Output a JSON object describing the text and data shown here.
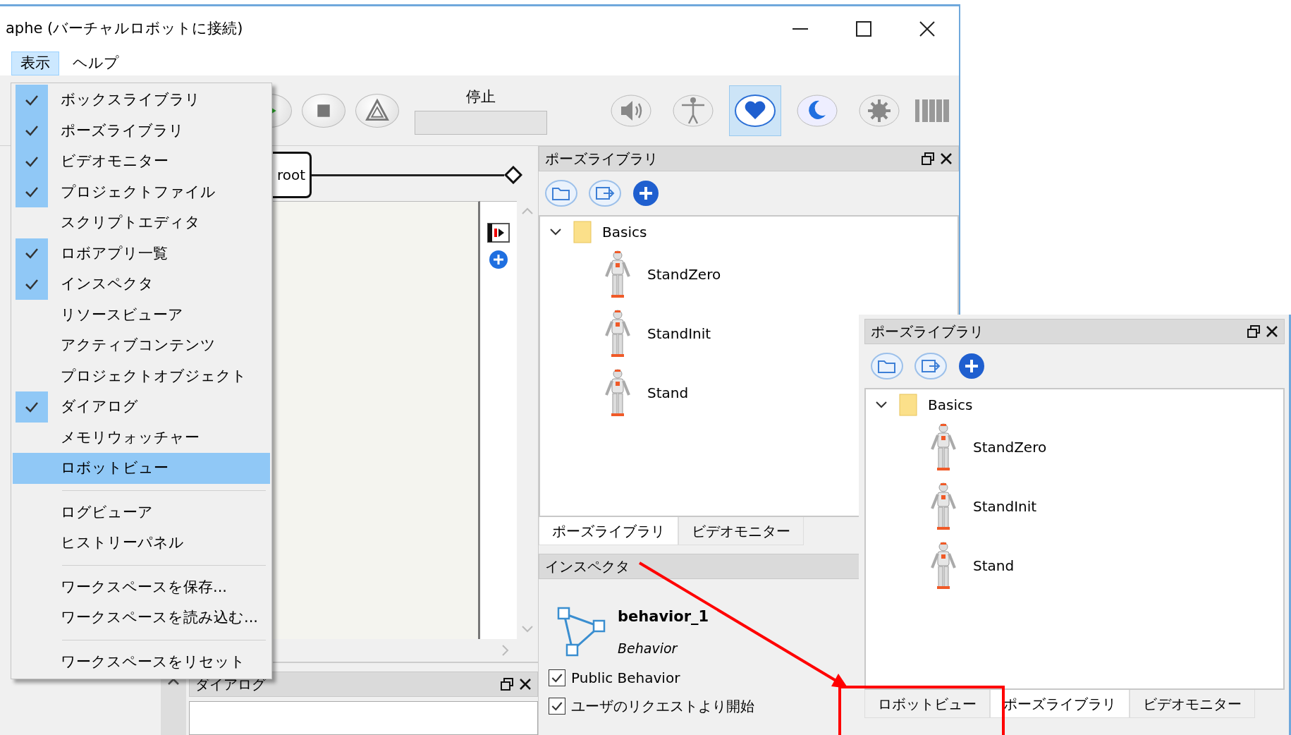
{
  "window": {
    "title": "aphe (バーチャルロボットに接続)"
  },
  "menubar": [
    {
      "label": "表示",
      "selected": true
    },
    {
      "label": "ヘルプ",
      "selected": false
    }
  ],
  "view_menu": [
    {
      "kind": "item",
      "label": "ボックスライブラリ",
      "checked": true,
      "selected": false
    },
    {
      "kind": "item",
      "label": "ポーズライブラリ",
      "checked": true,
      "selected": false
    },
    {
      "kind": "item",
      "label": "ビデオモニター",
      "checked": true,
      "selected": false
    },
    {
      "kind": "item",
      "label": "プロジェクトファイル",
      "checked": true,
      "selected": false
    },
    {
      "kind": "item",
      "label": "スクリプトエディタ",
      "checked": false,
      "selected": false
    },
    {
      "kind": "item",
      "label": "ロボアプリ一覧",
      "checked": true,
      "selected": false
    },
    {
      "kind": "item",
      "label": "インスペクタ",
      "checked": true,
      "selected": false
    },
    {
      "kind": "item",
      "label": "リソースビューア",
      "checked": false,
      "selected": false
    },
    {
      "kind": "item",
      "label": "アクティブコンテンツ",
      "checked": false,
      "selected": false
    },
    {
      "kind": "item",
      "label": "プロジェクトオブジェクト",
      "checked": false,
      "selected": false
    },
    {
      "kind": "item",
      "label": "ダイアログ",
      "checked": true,
      "selected": false
    },
    {
      "kind": "item",
      "label": "メモリウォッチャー",
      "checked": false,
      "selected": false
    },
    {
      "kind": "item",
      "label": "ロボットビュー",
      "checked": false,
      "selected": true
    },
    {
      "kind": "separator"
    },
    {
      "kind": "item",
      "label": "ログビューア",
      "checked": false,
      "selected": false
    },
    {
      "kind": "item",
      "label": "ヒストリーパネル",
      "checked": false,
      "selected": false
    },
    {
      "kind": "separator"
    },
    {
      "kind": "item",
      "label": "ワークスペースを保存...",
      "checked": false,
      "selected": false
    },
    {
      "kind": "item",
      "label": "ワークスペースを読み込む...",
      "checked": false,
      "selected": false
    },
    {
      "kind": "separator"
    },
    {
      "kind": "item",
      "label": "ワークスペースをリセット",
      "checked": false,
      "selected": false
    }
  ],
  "toolbar": {
    "status_label": "停止",
    "robot_buttons": [
      {
        "kind": "volume",
        "selected": false
      },
      {
        "kind": "posture",
        "selected": false
      },
      {
        "kind": "life",
        "selected": true
      },
      {
        "kind": "rest",
        "selected": false
      },
      {
        "kind": "settings",
        "selected": false
      }
    ]
  },
  "flow_diagram": {
    "node": "root"
  },
  "pose_library": {
    "title": "ポーズライブラリ",
    "tree": [
      {
        "label": "Basics",
        "expanded": true,
        "children": [
          {
            "label": "StandZero"
          },
          {
            "label": "StandInit"
          },
          {
            "label": "Stand"
          }
        ]
      }
    ],
    "tabs": [
      {
        "label": "ポーズライブラリ",
        "selected": true
      },
      {
        "label": "ビデオモニター",
        "selected": false
      }
    ]
  },
  "inspector": {
    "title": "インスペクタ",
    "name": "behavior_1",
    "type": "Behavior",
    "options": [
      {
        "label": "Public Behavior",
        "checked": true
      },
      {
        "label": "ユーザのリクエストより開始",
        "checked": true
      }
    ]
  },
  "dialog_panel": {
    "title": "ダイアログ"
  },
  "floating_pose_library": {
    "title": "ポーズライブラリ",
    "tree": [
      {
        "label": "Basics",
        "expanded": true,
        "children": [
          {
            "label": "StandZero"
          },
          {
            "label": "StandInit"
          },
          {
            "label": "Stand"
          }
        ]
      }
    ],
    "tabs": [
      {
        "label": "ロボットビュー",
        "selected": false
      },
      {
        "label": "ポーズライブラリ",
        "selected": true
      },
      {
        "label": "ビデオモニター",
        "selected": false
      }
    ]
  }
}
